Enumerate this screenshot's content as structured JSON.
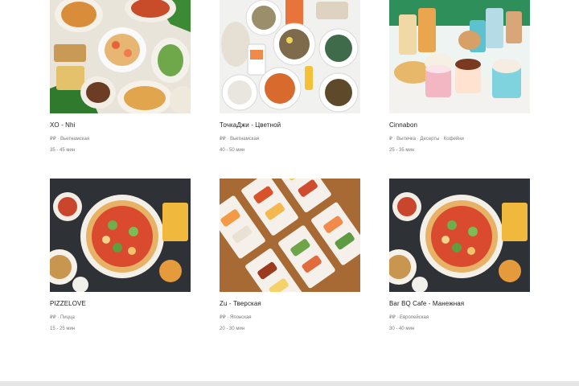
{
  "restaurants": [
    {
      "name": "XO - Nhi",
      "price": "₽₽",
      "cuisine": "Вьетнамская",
      "delivery_time": "35 - 45 мин"
    },
    {
      "name": "ТочкаДжи - Цветной",
      "price": "₽₽",
      "cuisine": "Вьетнамская",
      "delivery_time": "40 - 50 мин"
    },
    {
      "name": "Cinnabon",
      "price": "₽",
      "cuisine": "Выпечка · Десерты · Кофейни",
      "delivery_time": "25 - 35 мин"
    },
    {
      "name": "PIZZELOVE",
      "price": "₽₽",
      "cuisine": "Пицца",
      "delivery_time": "15 - 25 мин"
    },
    {
      "name": "Zu - Тверская",
      "price": "₽₽",
      "cuisine": "Японская",
      "delivery_time": "20 - 30 мин"
    },
    {
      "name": "Bar BQ Cafe - Манежная",
      "price": "₽₽",
      "cuisine": "Европейская",
      "delivery_time": "30 - 40 мин"
    }
  ],
  "colors": {
    "page_bg": "#ffffff",
    "text": "#222222",
    "meta": "#7a7a7a",
    "bottom_bar": "#e6e6e6"
  }
}
